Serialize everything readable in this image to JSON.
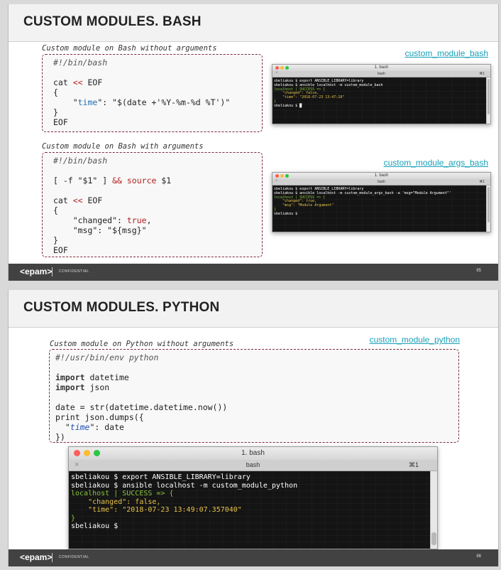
{
  "slide1": {
    "title": "CUSTOM MODULES. BASH",
    "footer": {
      "logo": "<epam>",
      "confidential": "CONFIDENTIAL",
      "page": "85"
    },
    "block1": {
      "caption": "Custom module on Bash without arguments",
      "link": "custom_module_bash",
      "code": {
        "shebang": "#!/bin/bash",
        "l1a": "cat ",
        "l1b": "<<",
        "l1c": " EOF",
        "l2": "{",
        "l3a": "    \"",
        "l3b": "time",
        "l3c": "\": \"$(date +'%Y-%m-%d %T')\"",
        "l4": "}",
        "l5": "EOF"
      },
      "terminal": {
        "window_title": "1. bash",
        "tab_title": "bash",
        "shortcut": "⌘1",
        "lines": [
          "sbeliakou $ export ANSIBLE_LIBRARY=library",
          "sbeliakou $ ansible localhost -m custom_module_bash",
          "localhost | SUCCESS => {",
          "    \"changed\": false,",
          "    \"time\": \"2018-07-23 13:47:28\"",
          "}",
          "sbeliakou $ █"
        ]
      }
    },
    "block2": {
      "caption": "Custom module on Bash with arguments",
      "link": "custom_module_args_bash",
      "code": {
        "shebang": "#!/bin/bash",
        "l1a": "[ -f \"$1\" ] ",
        "l1b": "&&",
        "l1c": " source",
        "l1d": " $1",
        "l2a": "cat ",
        "l2b": "<<",
        "l2c": " EOF",
        "l3": "{",
        "l4a": "    \"changed\": ",
        "l4b": "true",
        "l4c": ",",
        "l5": "    \"msg\": \"${msg}\"",
        "l6": "}",
        "l7": "EOF"
      },
      "terminal": {
        "window_title": "1. bash",
        "tab_title": "bash",
        "shortcut": "⌘1",
        "lines": [
          "sbeliakou $ export ANSIBLE_LIBRARY=library",
          "sbeliakou $ ansible localhost -m custom_module_args_bash -a 'msg=\"Module Argument\"'",
          "localhost | SUCCESS => {",
          "    \"changed\": true,",
          "    \"msg\": \"Module Argument\"",
          "}",
          "sbeliakou $"
        ]
      }
    }
  },
  "slide2": {
    "title": "CUSTOM MODULES. PYTHON",
    "footer": {
      "logo": "<epam>",
      "confidential": "CONFIDENTIAL",
      "page": "86"
    },
    "block": {
      "caption": "Custom module on Python without arguments",
      "link": "custom_module_python",
      "code": {
        "shebang": "#!/usr/bin/env python",
        "imp1a": "import",
        "imp1b": " datetime",
        "imp2a": "import",
        "imp2b": " json",
        "l1": "date = str(datetime.datetime.now())",
        "l2": "print json.dumps({",
        "l3a": "  \"",
        "l3b": "time",
        "l3c": "\": date",
        "l4": "})"
      },
      "terminal": {
        "window_title": "1. bash",
        "tab_title": "bash",
        "shortcut": "⌘1",
        "lines": [
          "sbeliakou $ export ANSIBLE_LIBRARY=library",
          "sbeliakou $ ansible localhost -m custom_module_python",
          "localhost | SUCCESS => {",
          "    \"changed\": false,",
          "    \"time\": \"2018-07-23 13:49:07.357040\"",
          "}",
          "sbeliakou $"
        ]
      }
    }
  },
  "colors": {
    "accent_link": "#1aa0b8",
    "footer_bg": "#424242",
    "code_border": "#7b2b3a",
    "terminal_green": "#8cc63f",
    "terminal_yellow": "#e6c24a"
  }
}
